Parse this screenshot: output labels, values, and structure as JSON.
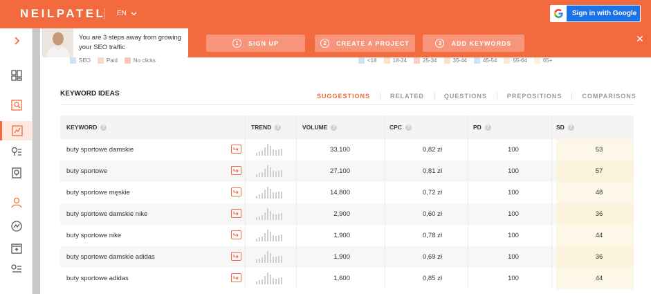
{
  "header": {
    "logo": "NEILPATEL",
    "language": "EN",
    "google_button_label": "Sign in with Google"
  },
  "onboarding": {
    "message": "You are 3 steps away from growing your SEO traffic",
    "steps": [
      {
        "num": "1",
        "label": "SIGN UP"
      },
      {
        "num": "2",
        "label": "CREATE A PROJECT"
      },
      {
        "num": "3",
        "label": "ADD KEYWORDS"
      }
    ],
    "close_label": "✕"
  },
  "legend_left": [
    {
      "label": "SEO",
      "color": "#cfe3f7"
    },
    {
      "label": "Paid",
      "color": "#f9d9cc"
    },
    {
      "label": "No clicks",
      "color": "#f9c9bd"
    }
  ],
  "legend_right": [
    {
      "label": "<18",
      "color": "#cfe3f7"
    },
    {
      "label": "18-24",
      "color": "#fde3c4"
    },
    {
      "label": "25-34",
      "color": "#f8cfc4"
    },
    {
      "label": "35-44",
      "color": "#fde0c4"
    },
    {
      "label": "45-54",
      "color": "#cfe3f7"
    },
    {
      "label": "55-64",
      "color": "#fbe6d4"
    },
    {
      "label": "65+",
      "color": "#fdf0dd"
    }
  ],
  "section": {
    "title": "KEYWORD IDEAS",
    "tabs": [
      "SUGGESTIONS",
      "RELATED",
      "QUESTIONS",
      "PREPOSITIONS",
      "COMPARISONS"
    ],
    "active_tab": "SUGGESTIONS"
  },
  "table": {
    "columns": [
      "KEYWORD",
      "TREND",
      "VOLUME",
      "CPC",
      "PD",
      "SD"
    ],
    "rows": [
      {
        "keyword": "buty sportowe damskie",
        "volume": "33,100",
        "cpc": "0,82 zł",
        "pd": "100",
        "sd": "53",
        "trend": [
          0.25,
          0.35,
          0.4,
          0.7,
          1.0,
          0.8,
          0.5,
          0.45,
          0.55,
          0.6
        ]
      },
      {
        "keyword": "buty sportowe",
        "volume": "27,100",
        "cpc": "0,81 zł",
        "pd": "100",
        "sd": "57",
        "trend": [
          0.25,
          0.35,
          0.4,
          0.7,
          1.0,
          0.8,
          0.5,
          0.45,
          0.55,
          0.6
        ]
      },
      {
        "keyword": "buty sportowe męskie",
        "volume": "14,800",
        "cpc": "0,72 zł",
        "pd": "100",
        "sd": "48",
        "trend": [
          0.25,
          0.35,
          0.45,
          0.75,
          1.0,
          0.8,
          0.55,
          0.5,
          0.6,
          0.6
        ]
      },
      {
        "keyword": "buty sportowe damskie nike",
        "volume": "2,900",
        "cpc": "0,60 zł",
        "pd": "100",
        "sd": "36",
        "trend": [
          0.25,
          0.3,
          0.4,
          0.65,
          1.0,
          0.75,
          0.5,
          0.45,
          0.55,
          0.6
        ]
      },
      {
        "keyword": "buty sportowe nike",
        "volume": "1,900",
        "cpc": "0,78 zł",
        "pd": "100",
        "sd": "44",
        "trend": [
          0.25,
          0.35,
          0.4,
          0.7,
          1.0,
          0.8,
          0.55,
          0.45,
          0.5,
          0.6
        ]
      },
      {
        "keyword": "buty sportowe damskie adidas",
        "volume": "1,900",
        "cpc": "0,69 zł",
        "pd": "100",
        "sd": "36",
        "trend": [
          0.3,
          0.35,
          0.45,
          0.7,
          1.0,
          0.8,
          0.55,
          0.5,
          0.6,
          0.6
        ]
      },
      {
        "keyword": "buty sportowe adidas",
        "volume": "1,600",
        "cpc": "0,85 zł",
        "pd": "100",
        "sd": "44",
        "trend": [
          0.25,
          0.35,
          0.4,
          0.7,
          1.0,
          0.85,
          0.5,
          0.45,
          0.55,
          0.6
        ]
      }
    ]
  },
  "sidebar": {
    "icons": [
      "expand-chevron-icon",
      "dashboard-icon",
      "site-audit-icon",
      "keyword-ideas-icon",
      "content-ideas-icon",
      "backlinks-icon",
      "traffic-analyzer-icon",
      "rank-tracker-icon",
      "chrome-extension-icon",
      "keyword-lists-icon"
    ],
    "active": "keyword-ideas-icon"
  },
  "colors": {
    "brand": "#f26a3d",
    "google_blue": "#1a73e8"
  }
}
